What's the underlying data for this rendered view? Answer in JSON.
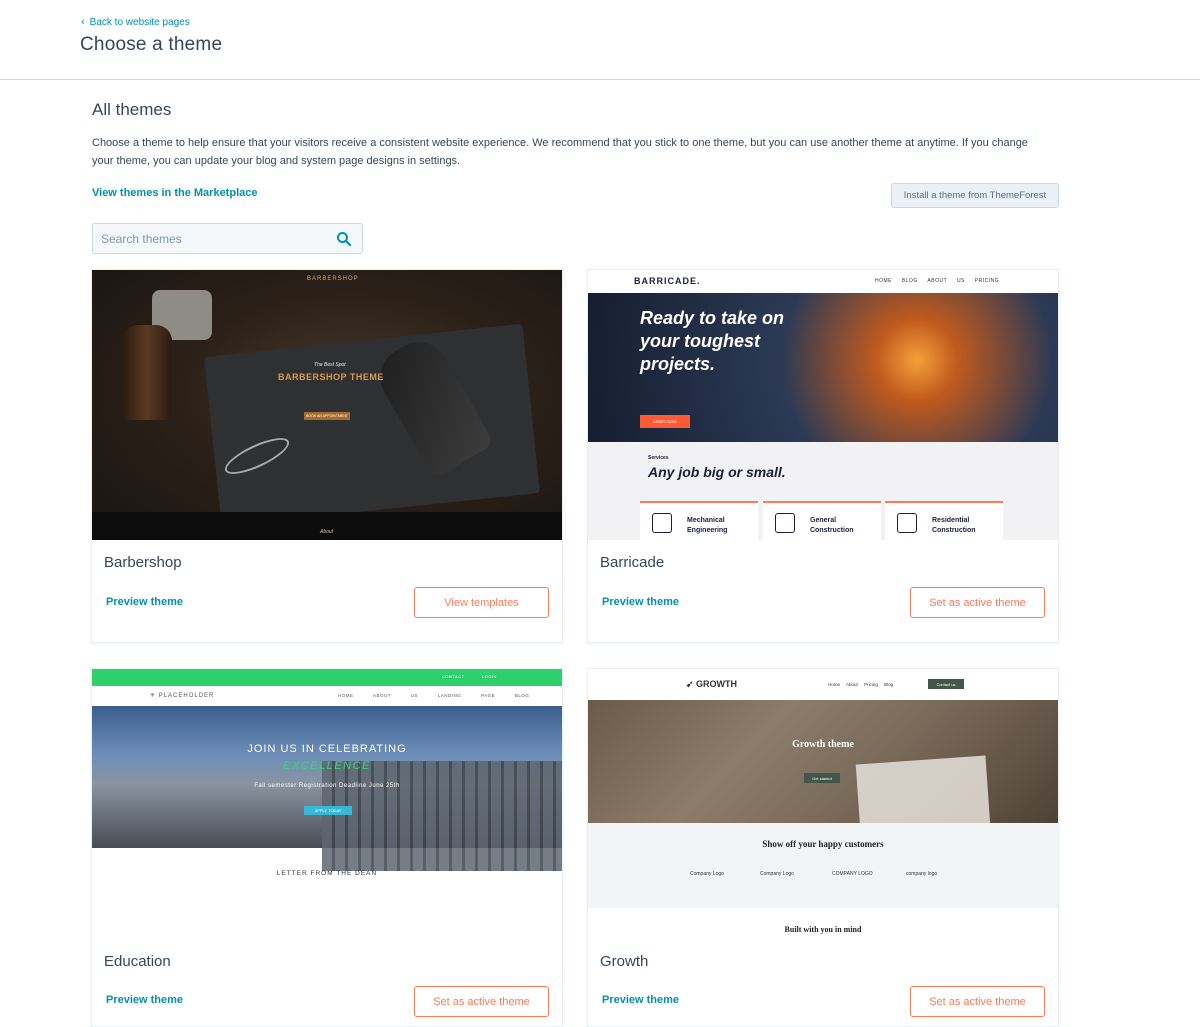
{
  "header": {
    "back_label": "Back to website pages",
    "title": "Choose a theme"
  },
  "section": {
    "title": "All themes",
    "description": "Choose a theme to help ensure that your visitors receive a consistent website experience. We recommend that you stick to one theme, but you can use another theme at anytime. If you change your theme, you can update your blog and system page designs in settings.",
    "marketplace_link": "View themes in the Marketplace",
    "install_button": "Install a theme from ThemeForest"
  },
  "search": {
    "placeholder": "Search themes",
    "value": "",
    "icon": "search-icon"
  },
  "themes": [
    {
      "name": "Barbershop",
      "preview_label": "Preview theme",
      "action_label": "View templates",
      "thumbnail": {
        "brand": "BARBERSHOP",
        "tagline": "The Best Spot",
        "headline": "BARBERSHOP THEME",
        "button": "BOOK AN APPOINTMENT",
        "footer": "About"
      }
    },
    {
      "name": "Barricade",
      "preview_label": "Preview theme",
      "action_label": "Set as active theme",
      "thumbnail": {
        "brand": "BARRICADE.",
        "menu": [
          "HOME",
          "BLOG",
          "ABOUT US",
          "PRICING"
        ],
        "headline": "Ready to take on your toughest projects.",
        "button": "Learn more",
        "section_label": "Services",
        "section_title": "Any job big or small.",
        "services": [
          "Mechanical Engineering",
          "General Construction",
          "Residential Construction"
        ]
      }
    },
    {
      "name": "Education",
      "preview_label": "Preview theme",
      "action_label": "Set as active theme",
      "thumbnail": {
        "topbar": [
          "CONTACT",
          "LOGIN"
        ],
        "brand": "PLACEHOLDER",
        "menu": [
          "HOME",
          "ABOUT US",
          "LANDING PAGE",
          "BLOG"
        ],
        "headline": "JOIN US IN CELEBRATING",
        "headline_accent": "EXCELLENCE",
        "subtext": "Fall semester Registration Deadline June 25th",
        "button": "APPLY TODAY",
        "section_title": "LETTER FROM THE DEAN"
      }
    },
    {
      "name": "Growth",
      "preview_label": "Preview theme",
      "action_label": "Set as active theme",
      "thumbnail": {
        "brand": "GROWTH",
        "menu": [
          "Home",
          "About",
          "Pricing",
          "Blog"
        ],
        "cta": "Contact us",
        "headline": "Growth theme",
        "button": "Get started",
        "section_title": "Show off your happy customers",
        "logos": [
          "Company Logo",
          "Company Logo",
          "COMPANY LOGO",
          "company logo"
        ],
        "footer_title": "Built with you in mind"
      }
    }
  ],
  "colors": {
    "link": "#0091ae",
    "accent": "#ff7a59",
    "text": "#33475b",
    "border": "#cbd6e2"
  }
}
